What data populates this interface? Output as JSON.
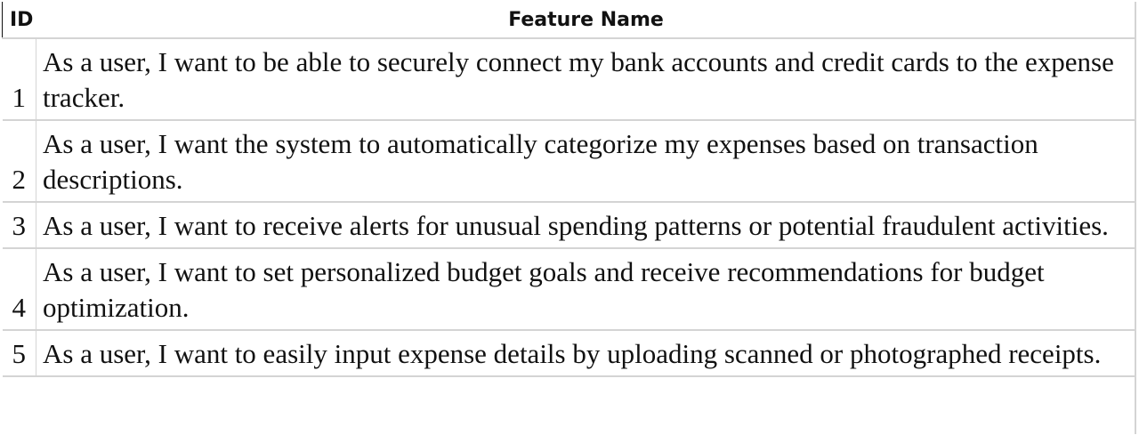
{
  "table": {
    "headers": {
      "id": "ID",
      "feature_name": "Feature Name"
    },
    "rows": [
      {
        "id": "1",
        "feature_name": "As a user, I want to be able to securely connect my bank accounts and credit cards to the expense tracker."
      },
      {
        "id": "2",
        "feature_name": "As a user, I want the system to automatically categorize my expenses based on transaction descriptions."
      },
      {
        "id": "3",
        "feature_name": "As a user, I want to receive alerts for unusual spending patterns or potential fraudulent activities."
      },
      {
        "id": "4",
        "feature_name": "As a user, I want to set personalized budget goals and receive recommendations for budget optimization."
      },
      {
        "id": "5",
        "feature_name": "As a user, I want to easily input expense details by uploading scanned or photographed receipts."
      }
    ]
  }
}
